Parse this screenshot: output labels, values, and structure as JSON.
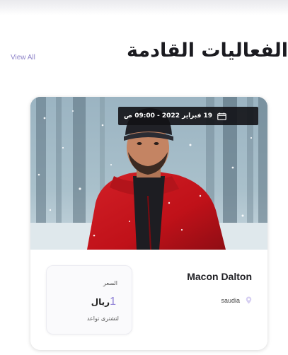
{
  "section": {
    "title": "الفعاليات القادمة",
    "view_all_label": "View All"
  },
  "events": [
    {
      "date_range": "19 فبراير 2022 - 09:00 ص",
      "name": "Macon Dalton",
      "location": "saudia",
      "price": {
        "label": "السعر",
        "value": "1",
        "currency": "ريال",
        "note": "لتشترى تواعد"
      },
      "icons": {
        "date": "calendar-icon",
        "location": "pin-icon"
      }
    }
  ],
  "colors": {
    "accent": "#8e7fd6",
    "view_all": "#8e83c9",
    "title": "#1b1b20",
    "badge_bg": "#121216"
  }
}
